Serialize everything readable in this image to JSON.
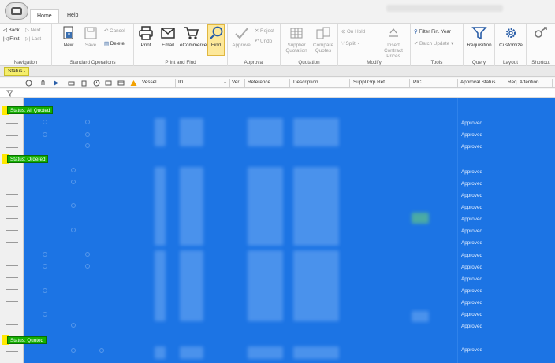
{
  "tabs": {
    "home": "Home",
    "help": "Help"
  },
  "ribbon": {
    "navigation": {
      "back": "Back",
      "next": "Next",
      "first": "First",
      "last": "Last",
      "group": "Navigation"
    },
    "standard": {
      "new": "New",
      "save": "Save",
      "cancel": "Cancel",
      "delete": "Delete",
      "group": "Standard Operations"
    },
    "print_find": {
      "print": "Print",
      "email": "Email",
      "ecommerce": "eCommerce",
      "find": "Find",
      "group": "Print and Find"
    },
    "approval": {
      "approve": "Approve",
      "reject": "Reject",
      "undo": "Undo",
      "group": "Approval"
    },
    "quotation": {
      "supplier_quotation": "Supplier Quotation",
      "compare_quotes": "Compare Quotes",
      "group": "Quotation"
    },
    "modify": {
      "on_hold": "On Hold",
      "split": "Split",
      "insert_contract_prices": "Insert Contract Prices",
      "group": "Modify"
    },
    "tools": {
      "filter_fin_year": "Filter Fin. Year",
      "batch_update": "Batch Update",
      "group": "Tools"
    },
    "query": {
      "requisition": "Requisition",
      "group": "Query"
    },
    "layout": {
      "customize": "Customize",
      "group": "Layout"
    },
    "shortcut": {
      "group": "Shortcut"
    }
  },
  "status_chip": "Status",
  "columns": {
    "vessel": "Vessel",
    "id": "ID",
    "ver": "Ver.",
    "reference": "Reference",
    "description": "Description",
    "suppl_grp_ref": "Suppl Grp Ref",
    "pic": "PIC",
    "approval_status": "Approval Status",
    "req_attention": "Req. Attention"
  },
  "groups": {
    "all_quoted": "Status: All Quoted",
    "ordered": "Status: Ordered",
    "quoted": "Status: Quoted"
  },
  "approved_label": "Approved",
  "colors": {
    "selection": "#1c74e4",
    "group_header": "#14b000",
    "highlight": "#ffe800",
    "find_active": "#fde89a"
  }
}
